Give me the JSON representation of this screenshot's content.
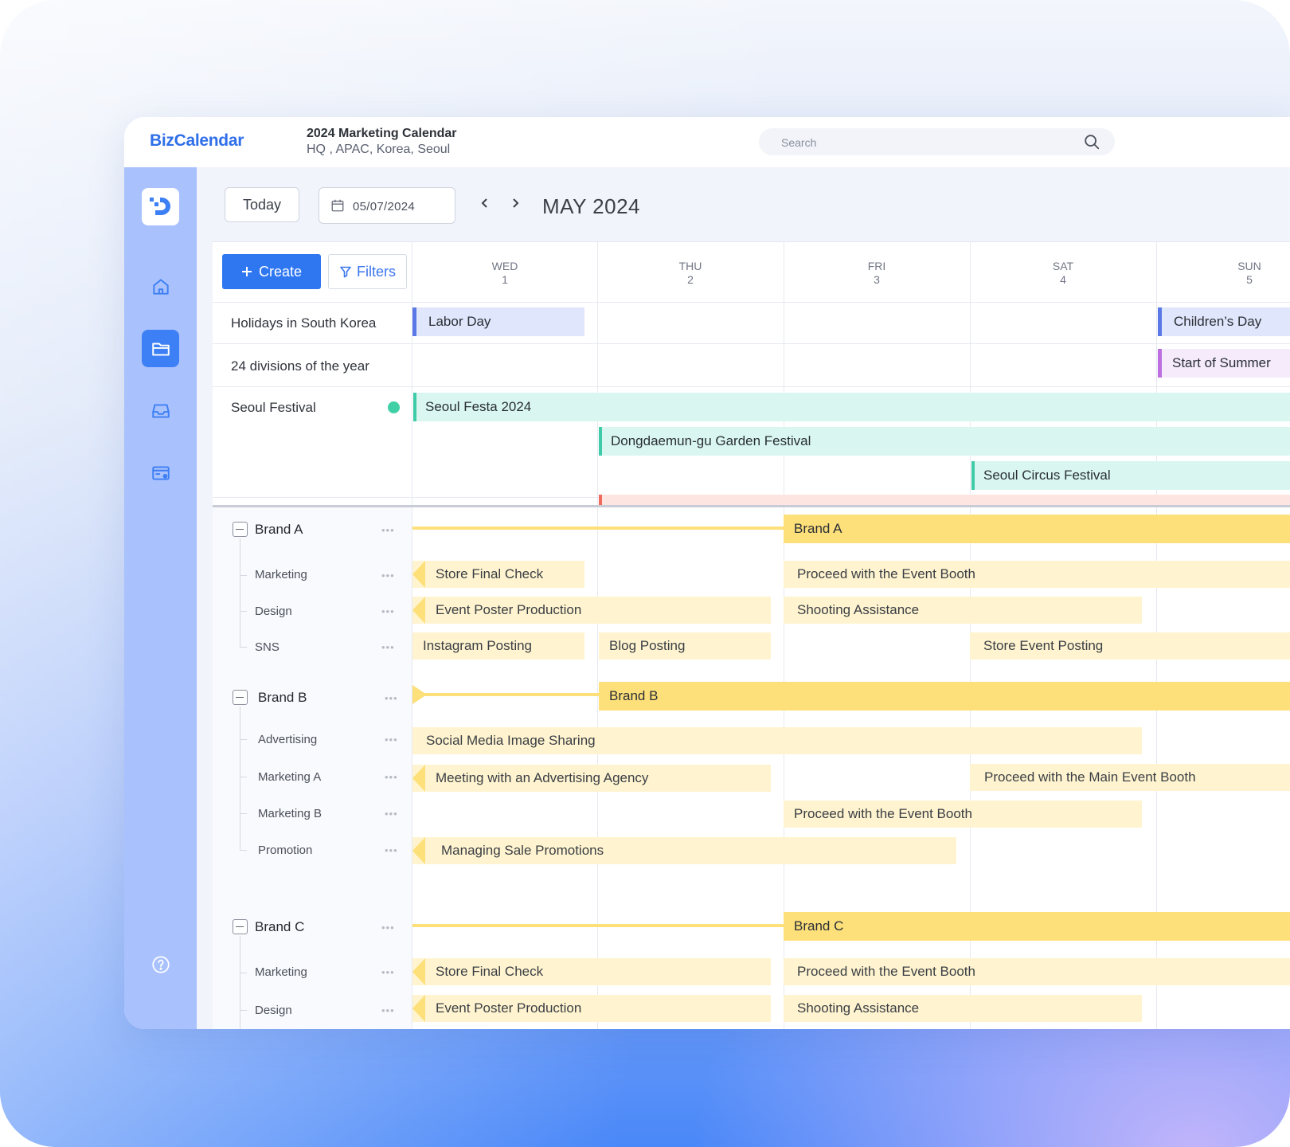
{
  "app": {
    "name": "BizCalendar"
  },
  "document": {
    "title": "2024 Marketing Calendar",
    "subtitle": "HQ , APAC, Korea, Seoul"
  },
  "search": {
    "placeholder": "Search"
  },
  "toolbar": {
    "today_label": "Today",
    "date_value": "05/07/2024",
    "month_label": "MAY 2024",
    "create_label": "Create",
    "filters_label": "Filters"
  },
  "days": [
    {
      "name": "WED",
      "num": "1"
    },
    {
      "name": "THU",
      "num": "2"
    },
    {
      "name": "FRI",
      "num": "3"
    },
    {
      "name": "SAT",
      "num": "4"
    },
    {
      "name": "SUN",
      "num": "5"
    }
  ],
  "calendars": {
    "holidays": {
      "label": "Holidays in South Korea",
      "events": [
        "Labor Day",
        "Children’s Day"
      ]
    },
    "divisions": {
      "label": "24 divisions of the year",
      "events": [
        "Start of Summer"
      ]
    },
    "festival": {
      "label": "Seoul Festival",
      "events": [
        "Seoul Festa 2024",
        "Dongdaemun-gu Garden Festival",
        "Seoul Circus Festival"
      ]
    }
  },
  "brands": [
    {
      "label": "Brand A",
      "subs": [
        "Marketing",
        "Design",
        "SNS"
      ],
      "tasks": [
        "Store Final Check",
        "Proceed with the Event Booth",
        "Event Poster Production",
        "Shooting Assistance",
        "Instagram Posting",
        "Blog Posting",
        "Store Event Posting"
      ]
    },
    {
      "label": "Brand B",
      "subs": [
        "Advertising",
        "Marketing A",
        "Marketing B",
        "Promotion"
      ],
      "tasks": [
        "Social Media Image Sharing",
        "Meeting with an Advertising Agency",
        "Proceed with the Main Event Booth",
        "Proceed with the Event Booth",
        "Managing Sale Promotions"
      ]
    },
    {
      "label": "Brand C",
      "subs": [
        "Marketing",
        "Design"
      ],
      "tasks": [
        "Store Final Check",
        "Proceed with the Event Booth",
        "Event Poster Production",
        "Shooting Assistance"
      ]
    }
  ],
  "more_glyph": "•••",
  "colors": {
    "brand_blue": "#2f77f1",
    "sidebar": "#a9c1fd",
    "brand_bar": "#fde07a",
    "task_bar": "#fff4cf",
    "festival": "#3fcba7"
  }
}
